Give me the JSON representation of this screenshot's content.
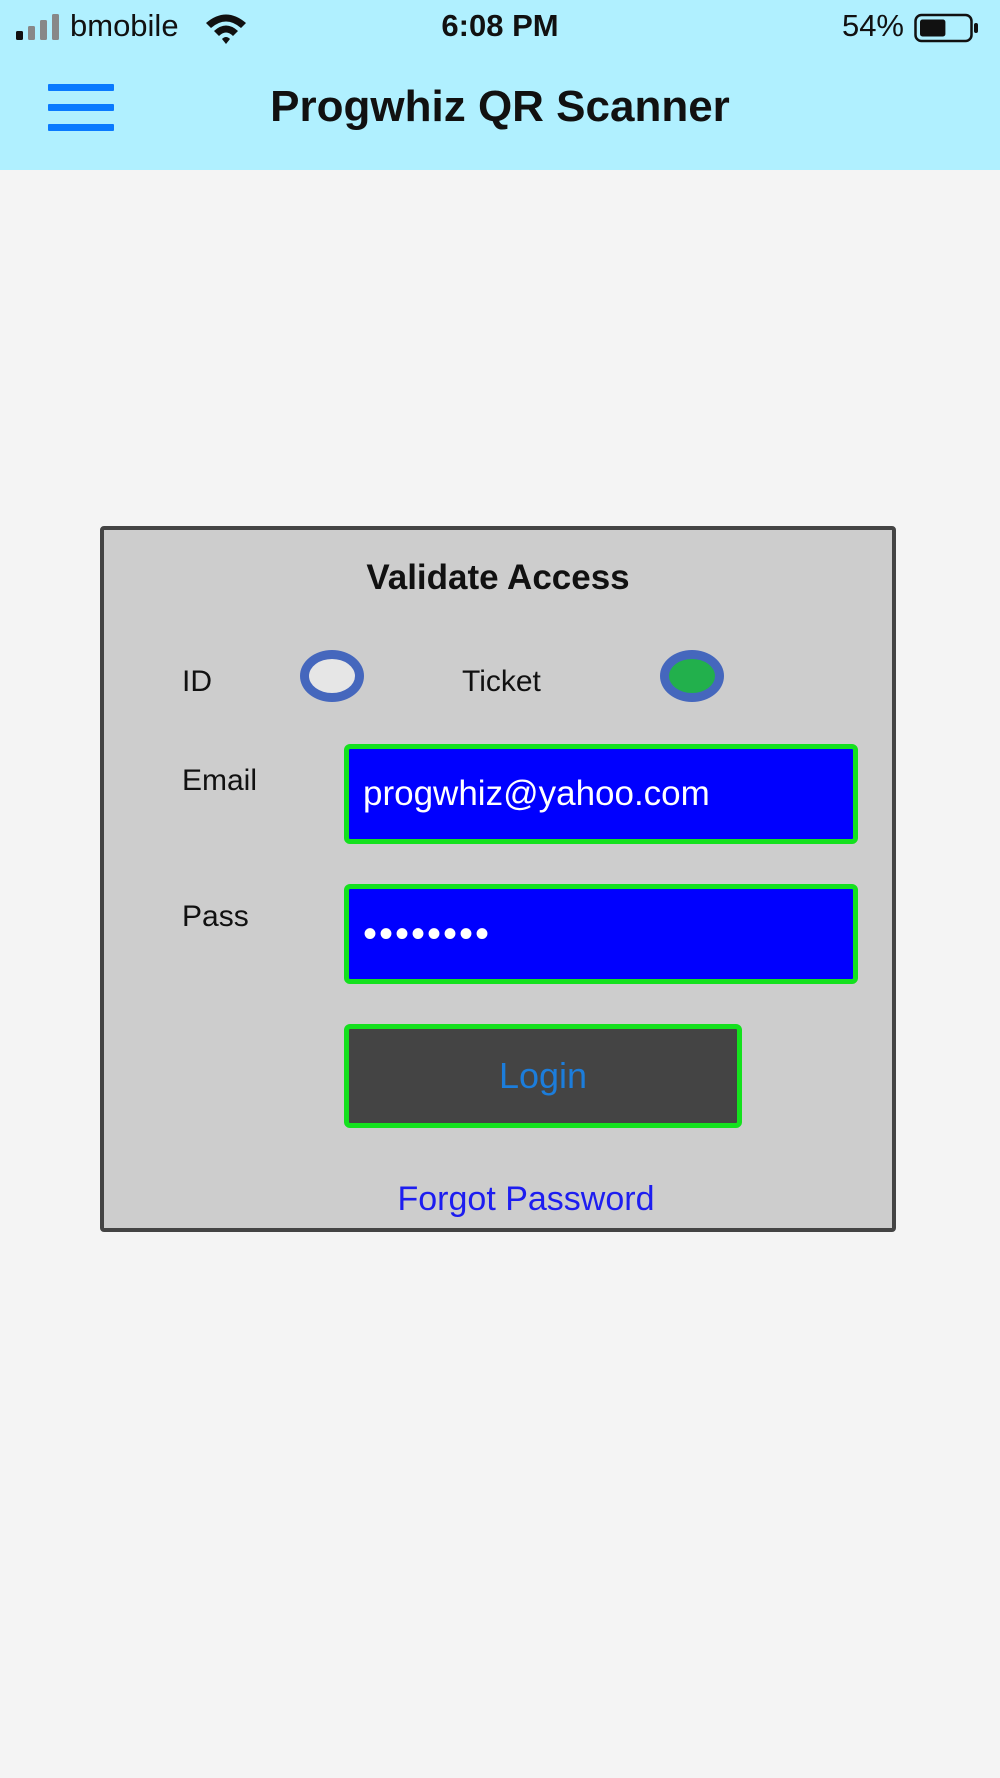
{
  "status_bar": {
    "carrier": "bmobile",
    "time": "6:08 PM",
    "battery_percent": "54%",
    "battery_level": 0.54,
    "signal_icon": "cellular-signal-icon",
    "wifi_icon": "wifi-icon",
    "battery_icon": "battery-icon"
  },
  "header": {
    "title": "Progwhiz QR Scanner",
    "menu_icon": "hamburger-menu-icon",
    "background": "#b0f0ff",
    "accent": "#0a7aff"
  },
  "card": {
    "title": "Validate Access",
    "mode": {
      "options": [
        {
          "label": "ID",
          "selected": false
        },
        {
          "label": "Ticket",
          "selected": true
        }
      ]
    },
    "email": {
      "label": "Email",
      "value": "progwhiz@yahoo.com"
    },
    "password": {
      "label": "Pass",
      "value": "••••••••"
    },
    "login_label": "Login",
    "forgot_label": "Forgot Password"
  },
  "colors": {
    "field_background": "#0000ff",
    "field_border": "#14e11e",
    "radio_ring": "#4567bd",
    "radio_checked": "#22b04c",
    "button_background": "#444444",
    "button_text": "#1c7ddb",
    "link": "#1d1df0"
  }
}
